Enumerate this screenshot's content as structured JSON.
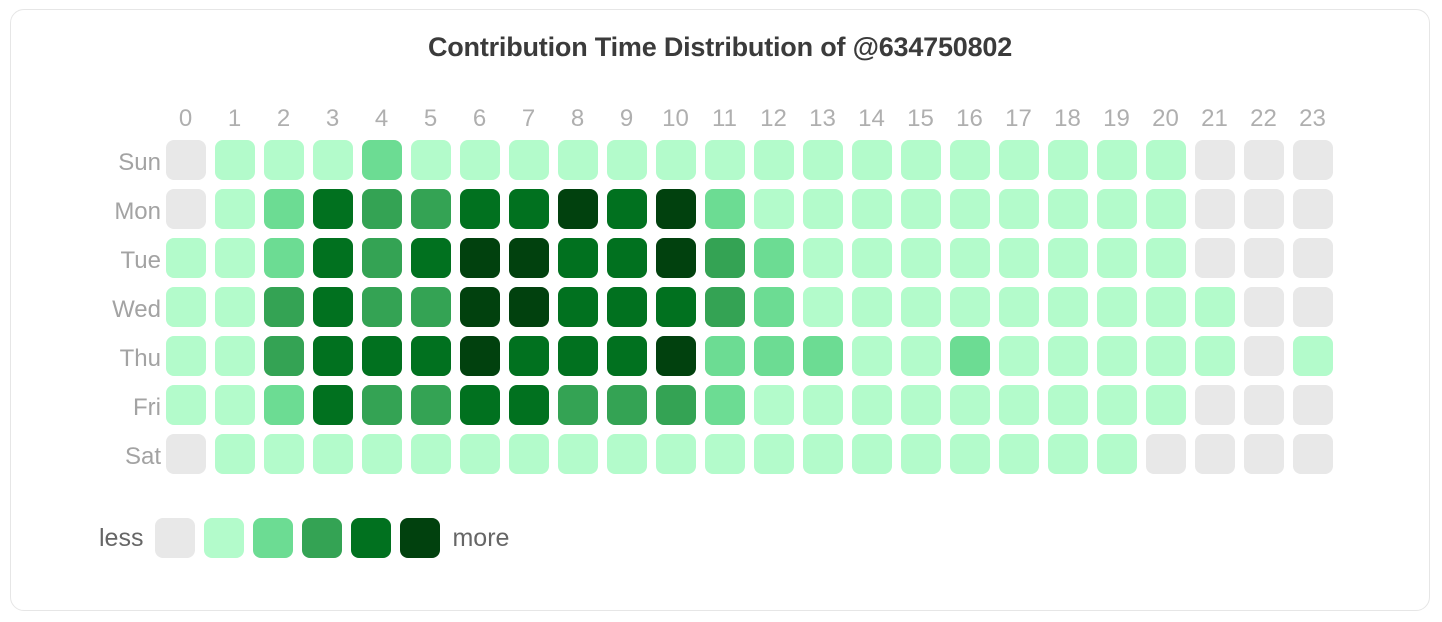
{
  "card": {
    "title": "Contribution Time Distribution of @634750802"
  },
  "legend": {
    "less_label": "less",
    "more_label": "more"
  },
  "palette": {
    "level0": "#e8e8e8",
    "level1": "#b3fbcb",
    "level2": "#6cdc93",
    "level3": "#37a košt"
  },
  "chart_data": {
    "type": "heatmap",
    "title": "Contribution Time Distribution of @634750802",
    "xlabel": "",
    "ylabel": "",
    "grid": false,
    "legend_position": "bottom-left",
    "colors": [
      "#e8e8e8",
      "#b3fbcb",
      "#6cdc93",
      "#34a354",
      "#01711f",
      "#01410e"
    ],
    "level_count": 6,
    "x": [
      "0",
      "1",
      "2",
      "3",
      "4",
      "5",
      "6",
      "7",
      "8",
      "9",
      "10",
      "11",
      "12",
      "13",
      "14",
      "15",
      "16",
      "17",
      "18",
      "19",
      "20",
      "21",
      "22",
      "23"
    ],
    "y": [
      "Sun",
      "Mon",
      "Tue",
      "Wed",
      "Thu",
      "Fri",
      "Sat"
    ],
    "series": [
      {
        "name": "Sun",
        "values": [
          0,
          1,
          1,
          1,
          2,
          1,
          1,
          1,
          1,
          1,
          1,
          1,
          1,
          1,
          1,
          1,
          1,
          1,
          1,
          1,
          1,
          0,
          0,
          0
        ]
      },
      {
        "name": "Mon",
        "values": [
          0,
          1,
          2,
          4,
          3,
          3,
          4,
          4,
          5,
          4,
          5,
          2,
          1,
          1,
          1,
          1,
          1,
          1,
          1,
          1,
          1,
          0,
          0,
          0
        ]
      },
      {
        "name": "Tue",
        "values": [
          1,
          1,
          2,
          4,
          3,
          4,
          5,
          5,
          4,
          4,
          5,
          3,
          2,
          1,
          1,
          1,
          1,
          1,
          1,
          1,
          1,
          0,
          0,
          0
        ]
      },
      {
        "name": "Wed",
        "values": [
          1,
          1,
          3,
          4,
          3,
          3,
          5,
          5,
          4,
          4,
          4,
          3,
          2,
          1,
          1,
          1,
          1,
          1,
          1,
          1,
          1,
          1,
          0,
          0
        ]
      },
      {
        "name": "Thu",
        "values": [
          1,
          1,
          3,
          4,
          4,
          4,
          5,
          4,
          4,
          4,
          5,
          2,
          2,
          2,
          1,
          1,
          2,
          1,
          1,
          1,
          1,
          1,
          0,
          1
        ]
      },
      {
        "name": "Fri",
        "values": [
          1,
          1,
          2,
          4,
          3,
          3,
          4,
          4,
          3,
          3,
          3,
          2,
          1,
          1,
          1,
          1,
          1,
          1,
          1,
          1,
          1,
          0,
          0,
          0
        ]
      },
      {
        "name": "Sat",
        "values": [
          0,
          1,
          1,
          1,
          1,
          1,
          1,
          1,
          1,
          1,
          1,
          1,
          1,
          1,
          1,
          1,
          1,
          1,
          1,
          1,
          0,
          0,
          0,
          0
        ]
      }
    ]
  }
}
